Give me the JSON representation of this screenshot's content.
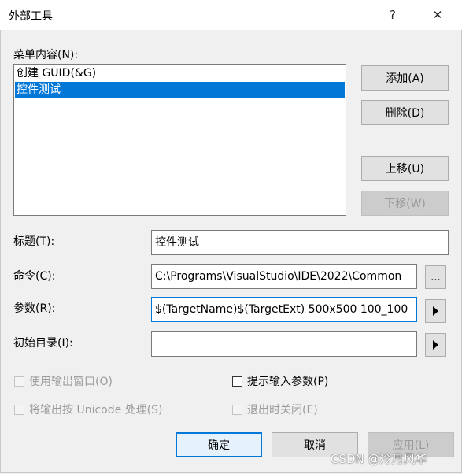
{
  "window": {
    "title": "外部工具",
    "help_glyph": "?",
    "close_glyph": "✕"
  },
  "menu": {
    "label": "菜单内容(N):",
    "items": [
      "创建 GUID(&G)",
      "控件测试"
    ],
    "selected_index": 1
  },
  "side_buttons": {
    "add": "添加(A)",
    "delete": "删除(D)",
    "move_up": "上移(U)",
    "move_down": "下移(W)"
  },
  "fields": {
    "title_label": "标题(T):",
    "title_value": "控件测试",
    "command_label": "命令(C):",
    "command_value": "C:\\Programs\\VisualStudio\\IDE\\2022\\Common",
    "browse_label": "...",
    "args_label": "参数(R):",
    "args_value": "$(TargetName)$(TargetExt) 500x500 100_100",
    "initdir_label": "初始目录(I):",
    "initdir_value": ""
  },
  "checkboxes": {
    "use_output_window": "使用输出窗口(O)",
    "prompt_args": "提示输入参数(P)",
    "treat_unicode": "将输出按 Unicode 处理(S)",
    "close_on_exit": "退出时关闭(E)"
  },
  "footer": {
    "ok": "确定",
    "cancel": "取消",
    "apply": "应用(L)"
  },
  "watermark": "CSDN @冷月风华",
  "colors": {
    "selection": "#0078d7",
    "dialog_bg": "#f0f0f0",
    "button_bg": "#e1e1e1"
  }
}
